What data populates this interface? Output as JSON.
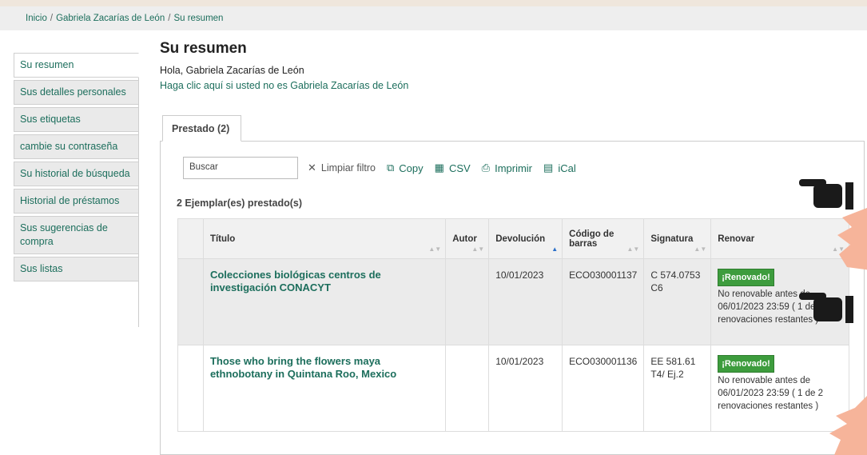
{
  "breadcrumb": [
    "Inicio",
    "Gabriela Zacarías de León",
    "Su resumen"
  ],
  "sidebar": {
    "items": [
      {
        "label": "Su resumen"
      },
      {
        "label": "Sus detalles personales"
      },
      {
        "label": "Sus etiquetas"
      },
      {
        "label": "cambie su contraseña"
      },
      {
        "label": "Su historial de búsqueda"
      },
      {
        "label": "Historial de préstamos"
      },
      {
        "label": "Sus sugerencias de compra"
      },
      {
        "label": "Sus listas"
      }
    ]
  },
  "main": {
    "title": "Su resumen",
    "greeting": "Hola, Gabriela Zacarías de León",
    "not_you_link": "Haga clic aquí si usted no es Gabriela Zacarías de León",
    "tab_label": "Prestado (2)"
  },
  "toolbar": {
    "search_placeholder": "Buscar",
    "clear_filter": "Limpiar filtro",
    "copy": "Copy",
    "csv": "CSV",
    "print": "Imprimir",
    "ical": "iCal"
  },
  "checkouts": {
    "count_label": "2 Ejemplar(es) prestado(s)",
    "columns": [
      "Título",
      "Autor",
      "Devolución",
      "Código de barras",
      "Signatura",
      "Renovar"
    ],
    "rows": [
      {
        "title": "Colecciones biológicas centros de investigación CONACYT",
        "author": "",
        "due": "10/01/2023",
        "barcode": "ECO030001137",
        "callnumber": "C 574.0753 C6",
        "badge": "¡Renovado!",
        "renew_note": "No renovable antes de 06/01/2023 23:59 ( 1 de 2 renovaciones restantes )"
      },
      {
        "title": "Those who bring the flowers maya ethnobotany in Quintana Roo, Mexico",
        "author": "",
        "due": "10/01/2023",
        "barcode": "ECO030001136",
        "callnumber": "EE 581.61 T4/ Ej.2",
        "badge": "¡Renovado!",
        "renew_note": "No renovable antes de 06/01/2023 23:59 ( 1 de 2 renovaciones restantes )"
      }
    ]
  },
  "colors": {
    "accent": "#1c6e5c",
    "badge": "#3d9c3d",
    "decor": "#f6b49a"
  },
  "icons": [
    "close-icon",
    "copy-icon",
    "table-icon",
    "print-icon",
    "calendar-icon",
    "pointing-hand-icon"
  ]
}
